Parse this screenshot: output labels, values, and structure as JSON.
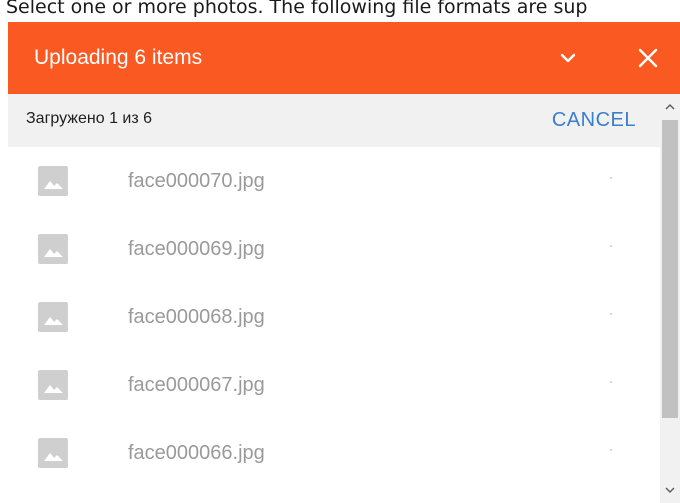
{
  "page": {
    "caption": "Select one or more photos. The following file formats are sup"
  },
  "header": {
    "title": "Uploading 6 items",
    "collapse_icon": "chevron-down-icon",
    "close_icon": "close-icon",
    "background_color": "#fa5a22"
  },
  "status": {
    "text": "Загружено 1 из 6",
    "cancel_label": "CANCEL",
    "cancel_color": "#3a7fcc"
  },
  "files": [
    {
      "name": "face000070.jpg",
      "icon": "image-icon"
    },
    {
      "name": "face000069.jpg",
      "icon": "image-icon"
    },
    {
      "name": "face000068.jpg",
      "icon": "image-icon"
    },
    {
      "name": "face000067.jpg",
      "icon": "image-icon"
    },
    {
      "name": "face000066.jpg",
      "icon": "image-icon"
    }
  ]
}
